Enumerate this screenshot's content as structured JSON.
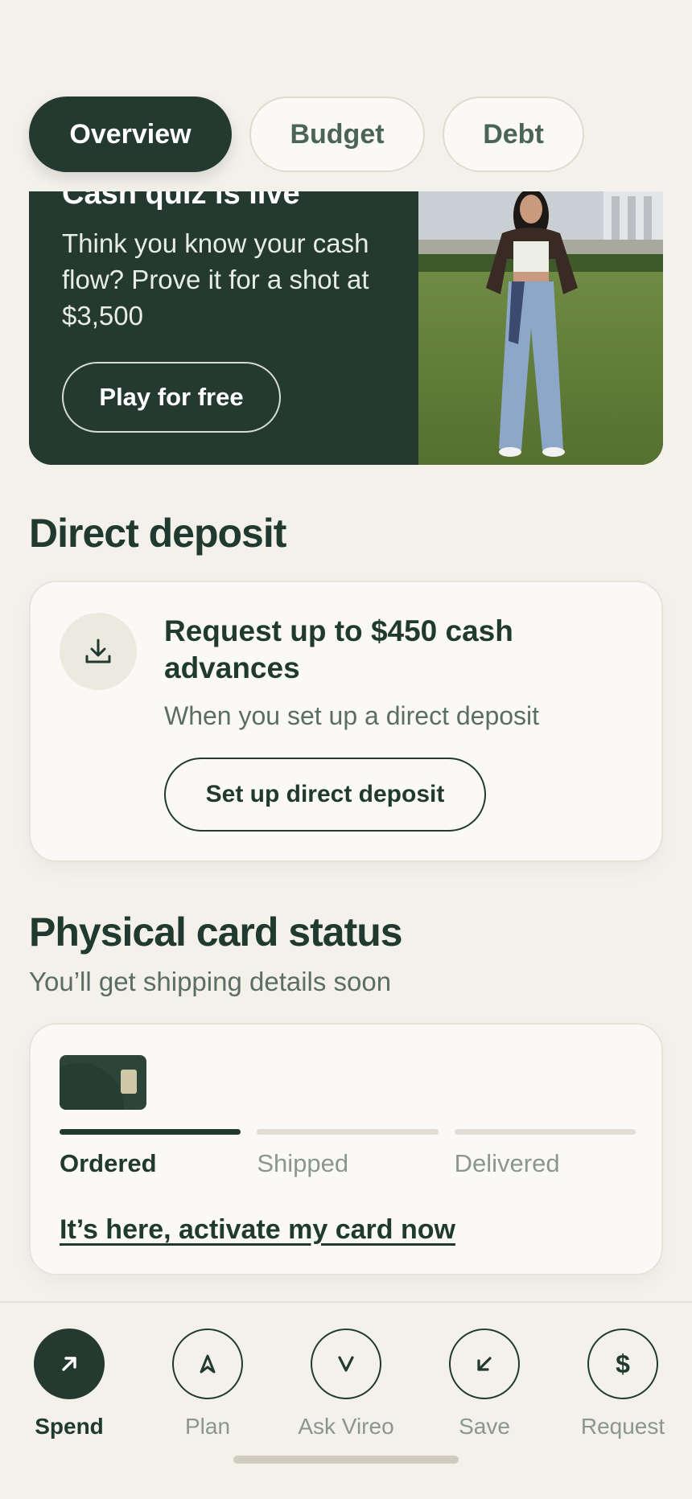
{
  "tabs": [
    {
      "label": "Overview",
      "active": true
    },
    {
      "label": "Budget",
      "active": false
    },
    {
      "label": "Debt",
      "active": false
    }
  ],
  "promo": {
    "title": "Cash quiz is live",
    "description": "Think you know your cash flow? Prove it for a shot at $3,500",
    "button_label": "Play for free"
  },
  "direct_deposit": {
    "heading": "Direct deposit",
    "icon": "download-icon",
    "title": "Request up to $450 cash advances",
    "subtitle": "When you set up a direct deposit",
    "button_label": "Set up direct deposit"
  },
  "card_status": {
    "heading": "Physical card status",
    "subtitle": "You’ll get shipping details soon",
    "steps": [
      {
        "label": "Ordered",
        "done": true
      },
      {
        "label": "Shipped",
        "done": false
      },
      {
        "label": "Delivered",
        "done": false
      }
    ],
    "activate_link": "It’s here, activate my card now"
  },
  "nav": {
    "items": [
      {
        "label": "Spend",
        "icon": "arrow-up-right-icon",
        "active": true
      },
      {
        "label": "Plan",
        "icon": "compass-arrow-icon",
        "active": false
      },
      {
        "label": "Ask Vireo",
        "icon": "v-letter-icon",
        "active": false
      },
      {
        "label": "Save",
        "icon": "arrow-down-left-icon",
        "active": false
      },
      {
        "label": "Request",
        "icon": "dollar-icon",
        "active": false
      }
    ]
  },
  "colors": {
    "background": "#f3f1ea",
    "primary": "#243a30",
    "card": "#faf9f6",
    "muted_text": "#5b6d64"
  }
}
